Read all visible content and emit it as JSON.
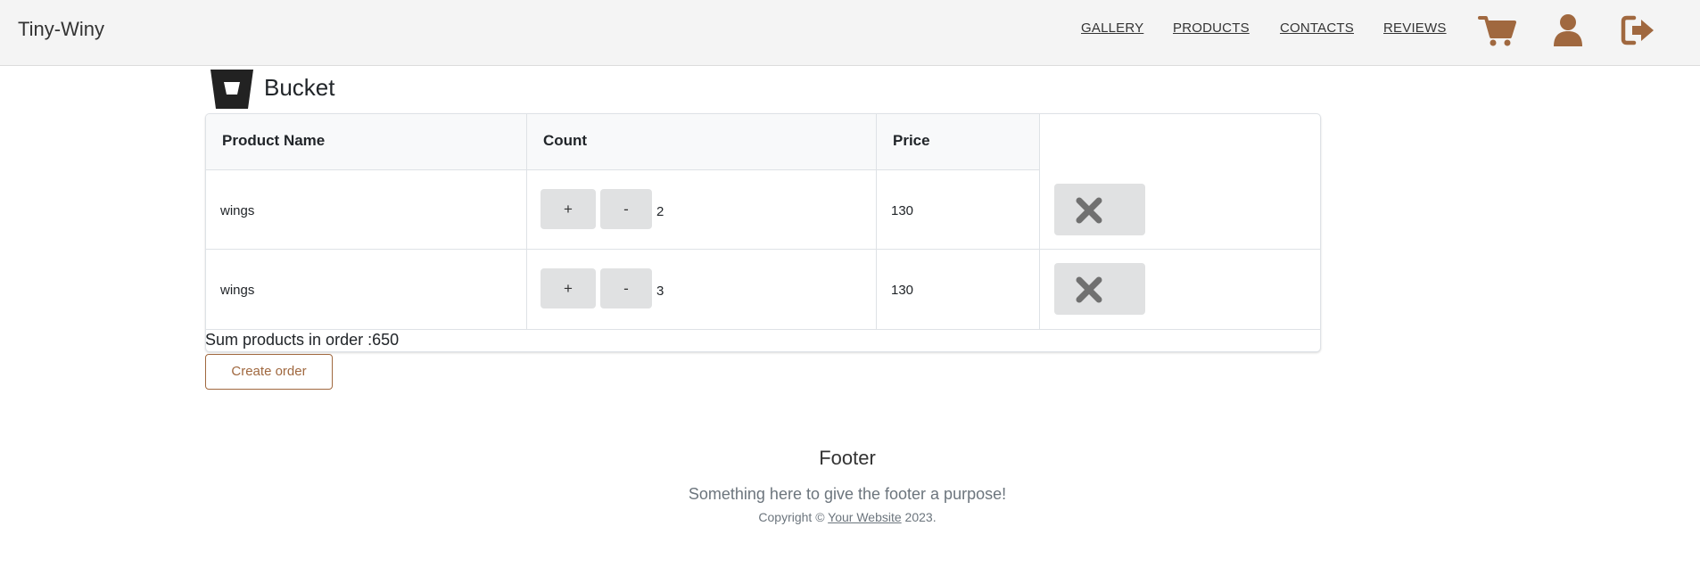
{
  "navbar": {
    "brand": "Tiny-Winy",
    "links": [
      "GALLERY",
      "PRODUCTS",
      "CONTACTS",
      "REVIEWS"
    ],
    "icons": [
      "cart-icon",
      "user-icon",
      "sign-out-icon"
    ],
    "accent_color": "#a0683f"
  },
  "page": {
    "title": "Bucket",
    "logo_icon": "bucket-icon"
  },
  "table": {
    "headers": {
      "product_name": "Product Name",
      "count": "Count",
      "price": "Price"
    },
    "rows": [
      {
        "name": "wings",
        "count": "2",
        "price": "130"
      },
      {
        "name": "wings",
        "count": "3",
        "price": "130"
      }
    ],
    "increment_label": "+",
    "decrement_label": "-",
    "delete_icon": "close-icon"
  },
  "summary": {
    "text": "Sum products in order :650"
  },
  "actions": {
    "create_order": "Create order"
  },
  "footer": {
    "title": "Footer",
    "text": "Something here to give the footer a purpose!",
    "copyright_prefix": "Copyright © ",
    "copyright_link": "Your Website",
    "copyright_suffix": " 2023."
  }
}
